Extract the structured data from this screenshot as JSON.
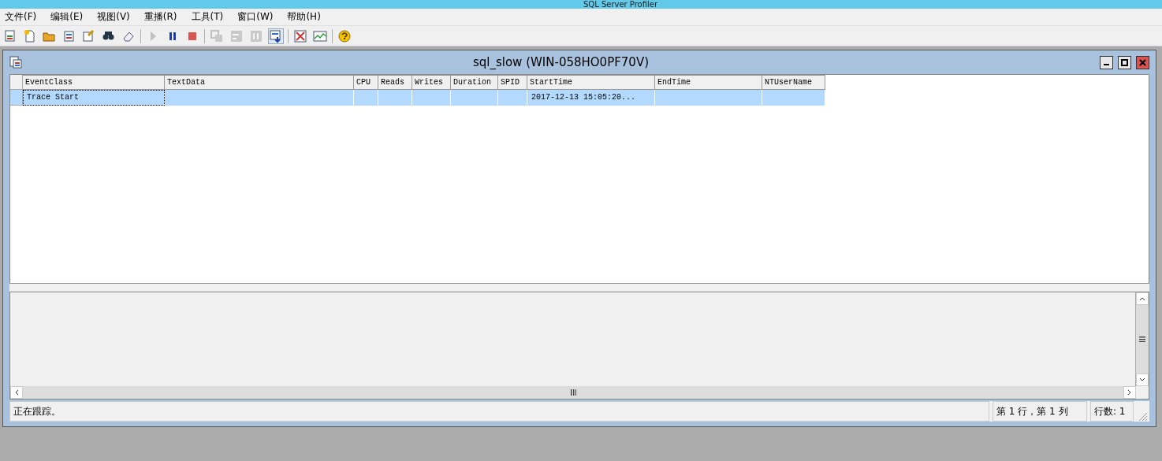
{
  "app_title": "SQL Server Profiler",
  "menu": [
    "文件(F)",
    "编辑(E)",
    "视图(V)",
    "重播(R)",
    "工具(T)",
    "窗口(W)",
    "帮助(H)"
  ],
  "toolbar": [
    {
      "kind": "button",
      "disabled": false,
      "pressed": false
    },
    {
      "kind": "button",
      "disabled": false,
      "pressed": false
    },
    {
      "kind": "button",
      "disabled": false,
      "pressed": false
    },
    {
      "kind": "button",
      "disabled": false,
      "pressed": false
    },
    {
      "kind": "button",
      "disabled": false,
      "pressed": false
    },
    {
      "kind": "button",
      "disabled": false,
      "pressed": false
    },
    {
      "kind": "button",
      "disabled": false,
      "pressed": false
    },
    {
      "kind": "separator"
    },
    {
      "kind": "button",
      "disabled": true,
      "pressed": false
    },
    {
      "kind": "button",
      "disabled": false,
      "pressed": false
    },
    {
      "kind": "button",
      "disabled": false,
      "pressed": false
    },
    {
      "kind": "separator"
    },
    {
      "kind": "button",
      "disabled": true,
      "pressed": false
    },
    {
      "kind": "button",
      "disabled": true,
      "pressed": false
    },
    {
      "kind": "button",
      "disabled": true,
      "pressed": false
    },
    {
      "kind": "button",
      "disabled": false,
      "pressed": true
    },
    {
      "kind": "separator"
    },
    {
      "kind": "button",
      "disabled": false,
      "pressed": false
    },
    {
      "kind": "button",
      "disabled": false,
      "pressed": false
    },
    {
      "kind": "separator"
    },
    {
      "kind": "button",
      "disabled": false,
      "pressed": false
    }
  ],
  "child_window": {
    "title": "sql_slow (WIN-058HO0PF70V)"
  },
  "table": {
    "columns": [
      "EventClass",
      "TextData",
      "CPU",
      "Reads",
      "Writes",
      "Duration",
      "SPID",
      "StartTime",
      "EndTime",
      "NTUserName"
    ],
    "rows": [
      {
        "selected": true,
        "cells": [
          "Trace Start",
          "",
          "",
          "",
          "",
          "",
          "",
          "2017-12-13 15:05:20...",
          "",
          ""
        ]
      }
    ]
  },
  "status_bar": {
    "message": "正在跟踪。",
    "position": "第 1 行，第 1 列",
    "row_count": "行数: 1"
  }
}
